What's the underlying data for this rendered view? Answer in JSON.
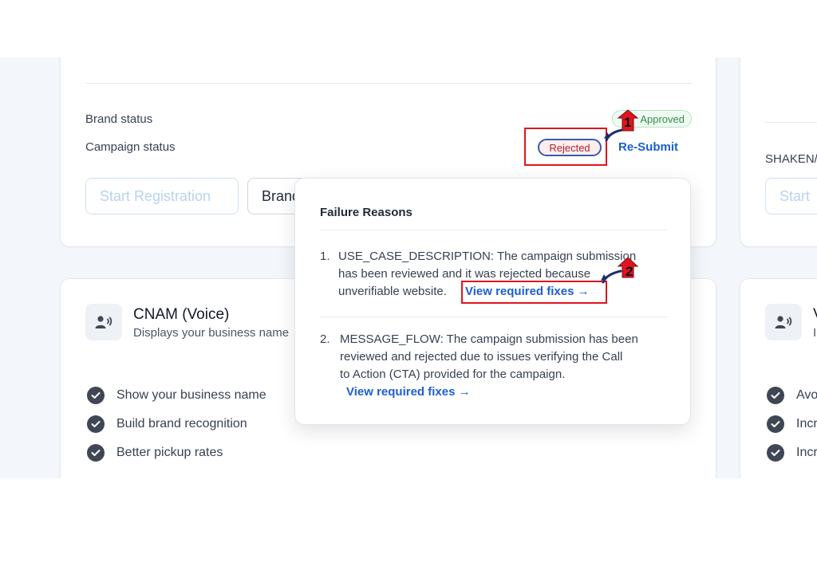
{
  "registration": {
    "brand_status_label": "Brand status",
    "brand_status_value": "Approved",
    "campaign_status_label": "Campaign status",
    "campaign_status_value": "Rejected",
    "resubmit_label": "Re-Submit",
    "start_registration_label": "Start Registration",
    "brand_button_label": "Brand"
  },
  "shaken_card": {
    "label": "SHAKEN/",
    "start_label": "Start"
  },
  "cnam_card": {
    "title": "CNAM (Voice)",
    "subtitle": "Displays your business name",
    "features": [
      "Show your business name",
      "Build brand recognition",
      "Better pickup rates"
    ]
  },
  "right_card": {
    "title": "V",
    "subtitle": "Ir",
    "features": [
      "Avo",
      "Incr",
      "Incr"
    ]
  },
  "failure_popover": {
    "title": "Failure Reasons",
    "reasons": [
      {
        "number": "1.",
        "lines": [
          "USE_CASE_DESCRIPTION: The campaign submission",
          "has been reviewed and it was rejected because",
          "unverifiable website."
        ],
        "link": "View required fixes →"
      },
      {
        "number": "2.",
        "lines": [
          "MESSAGE_FLOW: The campaign submission has been",
          "reviewed and rejected due to issues verifying the Call",
          "to Action (CTA) provided for the campaign."
        ],
        "link": "View required fixes →"
      }
    ]
  },
  "annotations": {
    "step1": "1",
    "step2": "2"
  },
  "colors": {
    "accent_blue": "#1d5fd1",
    "annotation_red": "#e0141e",
    "rejected_red": "#b4232c",
    "approved_green": "#2f8f4a"
  }
}
